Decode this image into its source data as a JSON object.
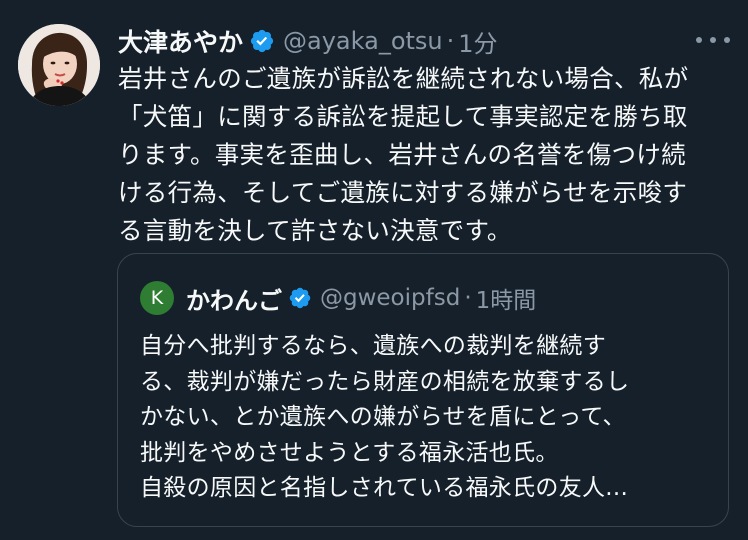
{
  "tweet": {
    "author": {
      "display_name": "大津あやか",
      "handle": "@ayaka_otsu",
      "avatar_icon": "profile-photo",
      "verified_icon": "verified-badge-icon"
    },
    "separator": "·",
    "time": "1分",
    "more_icon": "more-options-icon",
    "text_lines": [
      "岩井さんのご遺族が訴訟を継続されない場合、私が",
      "「犬笛」に関する訴訟を提起して事実認定を勝ち取",
      "ります。事実を歪曲し、岩井さんの名誉を傷つけ続",
      "ける行為、そしてご遺族に対する嫌がらせを示唆す",
      "る言動を決して許さない決意です。"
    ]
  },
  "quoted_tweet": {
    "author": {
      "avatar_initial": "K",
      "display_name": "かわんご",
      "handle": "@gweoipfsd",
      "verified_icon": "verified-badge-icon"
    },
    "separator": "·",
    "time": "1時間",
    "text_lines": [
      "自分へ批判するなら、遺族への裁判を継続す",
      "る、裁判が嫌だったら財産の相続を放棄するし",
      "かない、とか遺族への嫌がらせを盾にとって、",
      "批判をやめさせようとする福永活也氏。",
      "自殺の原因と名指しされている福永氏の友人..."
    ]
  },
  "colors": {
    "background": "#15202b",
    "text": "#f7f9f9",
    "secondary_text": "#8b98a5",
    "verified": "#1d9bf0",
    "quote_border": "#38444d",
    "quote_avatar": "#2e7d32"
  }
}
